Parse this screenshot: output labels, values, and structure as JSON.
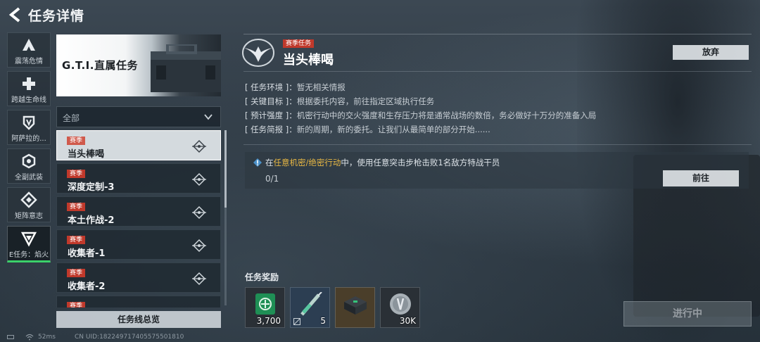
{
  "header": {
    "title": "任务详情"
  },
  "rail": {
    "items": [
      {
        "label": "震荡危情",
        "icon": "delta-a-icon"
      },
      {
        "label": "跨越生命线",
        "icon": "plus-cross-icon"
      },
      {
        "label": "阿萨拉的...",
        "icon": "shield-v-icon"
      },
      {
        "label": "全副武装",
        "icon": "hex-ring-icon"
      },
      {
        "label": "矩阵意志",
        "icon": "diamond-matrix-icon"
      },
      {
        "label": "E任务：焰火",
        "icon": "triangle-v-icon"
      }
    ]
  },
  "banner": {
    "title": "G.T.I.直属任务"
  },
  "filter": {
    "label": "全部"
  },
  "missions": [
    {
      "tag": "赛季",
      "name": "当头棒喝"
    },
    {
      "tag": "赛季",
      "name": "深度定制-3"
    },
    {
      "tag": "赛季",
      "name": "本土作战-2"
    },
    {
      "tag": "赛季",
      "name": "收集者-1"
    },
    {
      "tag": "赛季",
      "name": "收集者-2"
    },
    {
      "tag": "赛季",
      "name": ""
    }
  ],
  "overview_button": "任务线总览",
  "status": {
    "ping": "52ms",
    "uid": "CN UID:18224971740557550181​0"
  },
  "detail": {
    "season_tag": "赛季任务",
    "title": "当头棒喝",
    "abandon_label": "放弃",
    "info": [
      {
        "key": "[ 任务环境 ]：",
        "value": "暂无相关情报"
      },
      {
        "key": "[ 关键目标 ]：",
        "value": "根据委托内容，前往指定区域执行任务"
      },
      {
        "key": "[ 预计强度 ]：",
        "value": "机密行动中的交火强度和生存压力将是通常战场的数倍，务必做好十万分的准备入局"
      },
      {
        "key": "[ 任务简报 ]：",
        "value": "新的周期，新的委托。让我们从最简单的部分开始......"
      }
    ],
    "objective": {
      "prefix": "在",
      "highlight": "任意机密/绝密行动",
      "suffix": "中，使用任意突击步枪击败1名敌方特战干员",
      "progress": "0/1",
      "goto_label": "前往"
    },
    "rewards_label": "任务奖励",
    "rewards": [
      {
        "icon": "green-badge-icon",
        "qty": "3,700",
        "bg": "#2a3036"
      },
      {
        "icon": "syringe-icon",
        "qty": "5",
        "bg": "#2c3e52"
      },
      {
        "icon": "armor-case-icon",
        "qty": "",
        "bg": "#4a3e2a"
      },
      {
        "icon": "silver-coin-icon",
        "qty": "30K",
        "bg": "#2a3036"
      }
    ],
    "action_label": "进行中"
  },
  "colors": {
    "accent_green": "#3bd06a",
    "season_red": "#c0392b",
    "highlight_gold": "#e7b744"
  }
}
